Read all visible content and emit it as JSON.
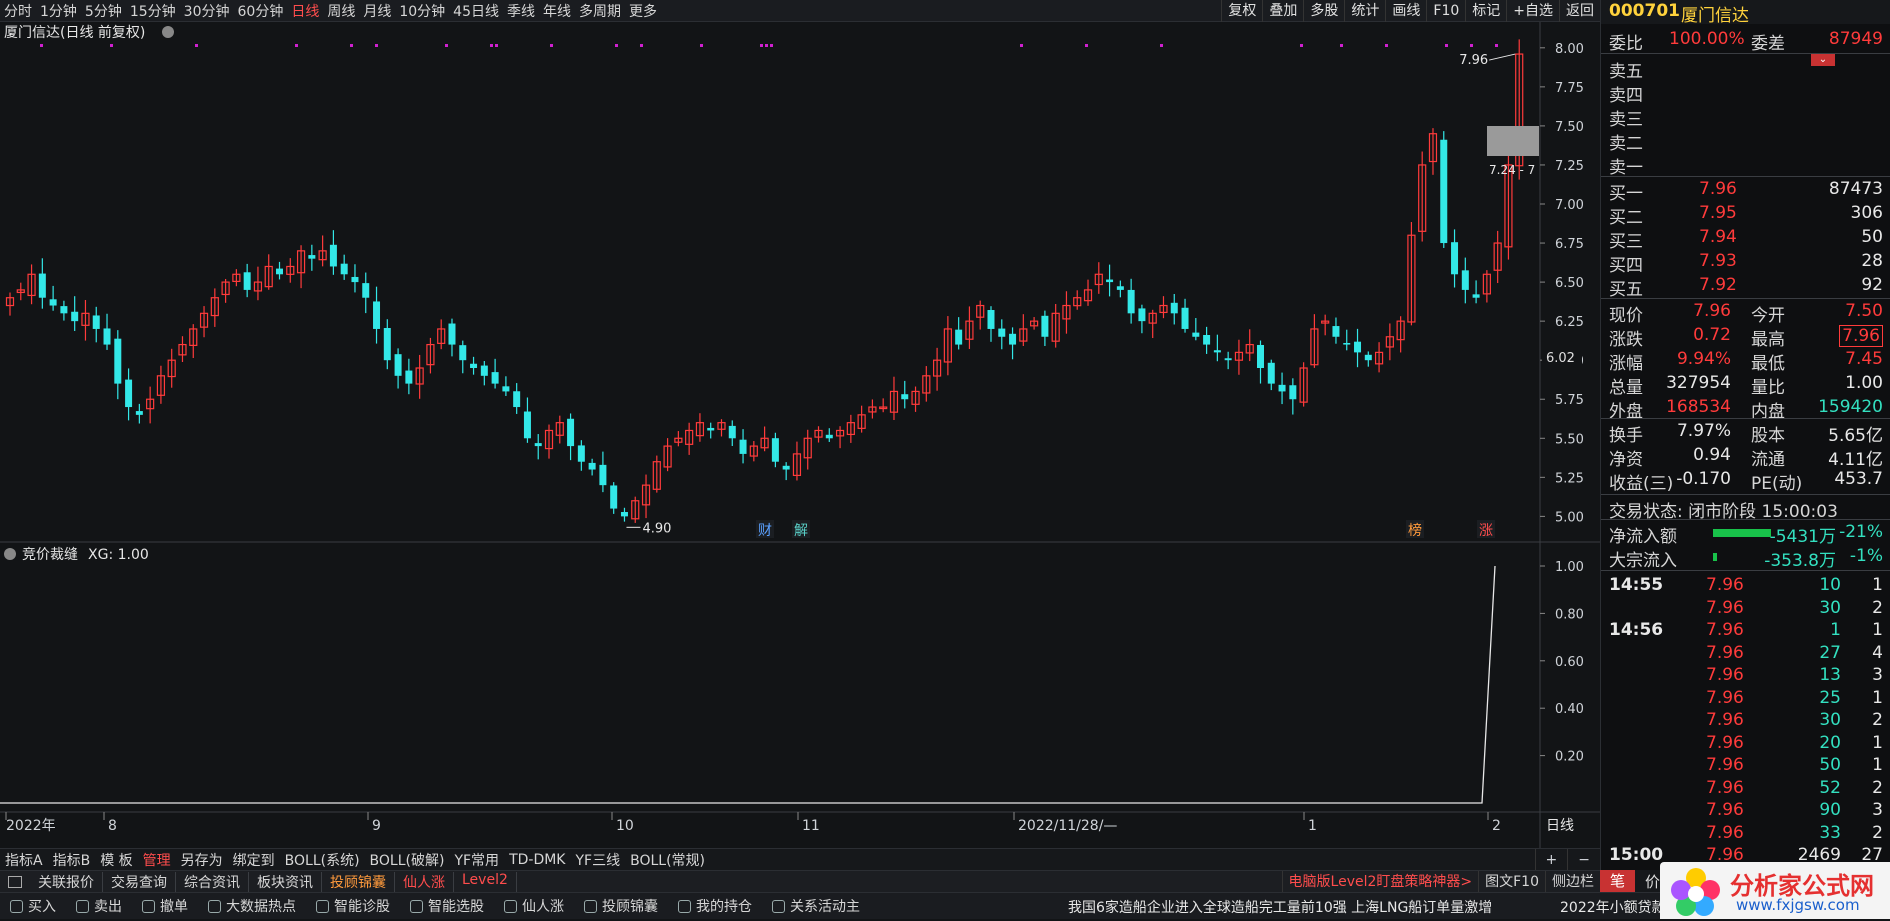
{
  "topbar": {
    "periods": [
      "分时",
      "1分钟",
      "5分钟",
      "15分钟",
      "30分钟",
      "60分钟",
      "日线",
      "周线",
      "月线",
      "10分钟",
      "45日线",
      "季线",
      "年线",
      "多周期",
      "更多"
    ],
    "active_period": "日线",
    "tools": [
      "复权",
      "叠加",
      "多股",
      "统计",
      "画线",
      "F10",
      "标记",
      "+自选",
      "返回"
    ]
  },
  "main_chart": {
    "title": "厦门信达(日线 前复权)",
    "price_axis": [
      "8.00",
      "7.75",
      "7.50",
      "7.25",
      "7.00",
      "6.75",
      "6.50",
      "6.25",
      "6.00",
      "5.75",
      "5.50",
      "5.25",
      "5.00"
    ],
    "current_price_tag": "6.02",
    "high_label": "7.96",
    "low_label": "4.90",
    "range_label": "7.24 - 7",
    "markers": [
      "财",
      "解",
      "榜",
      "涨"
    ]
  },
  "sub_chart": {
    "title": "竞价裁缝",
    "value_label": "XG: 1.00",
    "axis": [
      "1.00",
      "0.80",
      "0.60",
      "0.40",
      "0.20"
    ]
  },
  "date_axis": [
    "2022年",
    "8",
    "9",
    "10",
    "11",
    "2022/11/28/—",
    "1",
    "2"
  ],
  "period_label": "日线",
  "chart_data": [
    {
      "type": "candlestick",
      "title": "厦门信达(日线 前复权)",
      "ylim": [
        4.9,
        8.05
      ],
      "approx_close": [
        6.4,
        6.45,
        6.55,
        6.4,
        6.35,
        6.3,
        6.25,
        6.3,
        6.2,
        6.1,
        5.85,
        5.7,
        5.65,
        5.75,
        5.9,
        6.0,
        6.1,
        6.2,
        6.3,
        6.4,
        6.5,
        6.55,
        6.45,
        6.5,
        6.6,
        6.55,
        6.6,
        6.7,
        6.65,
        6.7,
        6.6,
        6.55,
        6.5,
        6.4,
        6.2,
        6.0,
        5.9,
        5.85,
        5.95,
        6.1,
        6.2,
        6.1,
        6.0,
        5.95,
        5.9,
        5.85,
        5.8,
        5.7,
        5.5,
        5.45,
        5.55,
        5.6,
        5.45,
        5.35,
        5.3,
        5.2,
        5.05,
        5.0,
        5.1,
        5.2,
        5.35,
        5.45,
        5.5,
        5.55,
        5.6,
        5.55,
        5.6,
        5.5,
        5.4,
        5.45,
        5.5,
        5.35,
        5.3,
        5.4,
        5.5,
        5.55,
        5.5,
        5.55,
        5.6,
        5.65,
        5.7,
        5.7,
        5.8,
        5.75,
        5.8,
        5.9,
        6.0,
        6.2,
        6.1,
        6.25,
        6.35,
        6.2,
        6.15,
        6.1,
        6.2,
        6.25,
        6.15,
        6.3,
        6.35,
        6.4,
        6.45,
        6.55,
        6.5,
        6.45,
        6.3,
        6.25,
        6.3,
        6.35,
        6.3,
        6.2,
        6.15,
        6.1,
        6.05,
        6.0,
        6.05,
        6.1,
        5.95,
        5.85,
        5.8,
        5.75,
        5.95,
        6.2,
        6.25,
        6.15,
        6.1,
        6.05,
        6.0,
        6.05,
        6.15,
        6.25,
        6.8,
        7.25,
        7.45,
        6.75,
        6.55,
        6.45,
        6.4,
        6.55,
        6.75,
        7.25,
        7.96
      ]
    },
    {
      "type": "line",
      "title": "竞价裁缝",
      "ylim": [
        0,
        1.0
      ],
      "series": [
        {
          "name": "XG",
          "last_value": 1.0
        }
      ]
    }
  ],
  "quote": {
    "code": "000701",
    "name": "厦门信达",
    "weibi_label": "委比",
    "weibi": "100.00%",
    "weicha_label": "委差",
    "weicha": "87949",
    "sell": [
      {
        "label": "卖五"
      },
      {
        "label": "卖四"
      },
      {
        "label": "卖三"
      },
      {
        "label": "卖二"
      },
      {
        "label": "卖一"
      }
    ],
    "buy": [
      {
        "label": "买一",
        "price": "7.96",
        "vol": "87473"
      },
      {
        "label": "买二",
        "price": "7.95",
        "vol": "306"
      },
      {
        "label": "买三",
        "price": "7.94",
        "vol": "50"
      },
      {
        "label": "买四",
        "price": "7.93",
        "vol": "28"
      },
      {
        "label": "买五",
        "price": "7.92",
        "vol": "92"
      }
    ],
    "stats": [
      {
        "l1": "现价",
        "v1": "7.96",
        "l2": "今开",
        "v2": "7.50"
      },
      {
        "l1": "涨跌",
        "v1": "0.72",
        "l2": "最高",
        "v2": "7.96"
      },
      {
        "l1": "涨幅",
        "v1": "9.94%",
        "l2": "最低",
        "v2": "7.45"
      },
      {
        "l1": "总量",
        "v1": "327954",
        "l2": "量比",
        "v2": "1.00"
      },
      {
        "l1": "外盘",
        "v1": "168534",
        "l2": "内盘",
        "v2": "159420"
      }
    ],
    "stats2": [
      {
        "l1": "换手",
        "v1": "7.97%",
        "l2": "股本",
        "v2": "5.65亿"
      },
      {
        "l1": "净资",
        "v1": "0.94",
        "l2": "流通",
        "v2": "4.11亿"
      },
      {
        "l1": "收益(三)",
        "v1": "-0.170",
        "l2": "PE(动)",
        "v2": "453.7"
      }
    ],
    "trade_status": "交易状态: 闭市阶段 15:00:03",
    "flow": [
      {
        "label": "净流入额",
        "value": "-5431万",
        "pct": "-21%"
      },
      {
        "label": "大宗流入",
        "value": "-353.8万",
        "pct": "-1%"
      }
    ],
    "ticks": [
      {
        "time": "14:55",
        "price": "7.96",
        "vol": "10",
        "n": "1"
      },
      {
        "time": "",
        "price": "7.96",
        "vol": "30",
        "n": "2"
      },
      {
        "time": "14:56",
        "price": "7.96",
        "vol": "1",
        "n": "1"
      },
      {
        "time": "",
        "price": "7.96",
        "vol": "27",
        "n": "4"
      },
      {
        "time": "",
        "price": "7.96",
        "vol": "13",
        "n": "3"
      },
      {
        "time": "",
        "price": "7.96",
        "vol": "25",
        "n": "1"
      },
      {
        "time": "",
        "price": "7.96",
        "vol": "30",
        "n": "2"
      },
      {
        "time": "",
        "price": "7.96",
        "vol": "20",
        "n": "1"
      },
      {
        "time": "",
        "price": "7.96",
        "vol": "50",
        "n": "1"
      },
      {
        "time": "",
        "price": "7.96",
        "vol": "52",
        "n": "2"
      },
      {
        "time": "",
        "price": "7.96",
        "vol": "90",
        "n": "3"
      },
      {
        "time": "",
        "price": "7.96",
        "vol": "33",
        "n": "2"
      },
      {
        "time": "15:00",
        "price": "7.96",
        "vol": "2469",
        "n": "27"
      }
    ],
    "bottom_tabs": [
      "笔",
      "价"
    ]
  },
  "indicator_tabs": [
    "指标A",
    "指标B",
    "模 板",
    "管理",
    "另存为",
    "绑定到",
    "BOLL(系统)",
    "BOLL(破解)",
    "YF常用",
    "TD-DMK",
    "YF三线",
    "BOLL(常规)"
  ],
  "indicator_active": "管理",
  "sub_plus": "+",
  "sub_minus": "−",
  "toolbar2": [
    "关联报价",
    "交易查询",
    "综合资讯",
    "板块资讯",
    "投顾锦囊",
    "仙人涨",
    "Level2"
  ],
  "toolbar2_right": [
    "电脑版Level2盯盘策略神器>",
    "图文F10",
    "侧边栏"
  ],
  "bottom_bar": [
    "买入",
    "卖出",
    "撤单",
    "大数据热点",
    "智能诊股",
    "智能选股",
    "仙人涨",
    "投顾锦囊",
    "我的持仓",
    "关系活动主"
  ],
  "ticker": "我国6家造船企业进入全球造船完工量前10强  上海LNG船订单量激增",
  "ticker_right": "2022年小额贷款公",
  "logo": {
    "name": "分析家公式网",
    "url": "www.fxjgsw.com"
  },
  "colors": {
    "up": "#ff3b3b",
    "down": "#33e8e8",
    "bg": "#121416",
    "accent": "#ff4d4d"
  }
}
